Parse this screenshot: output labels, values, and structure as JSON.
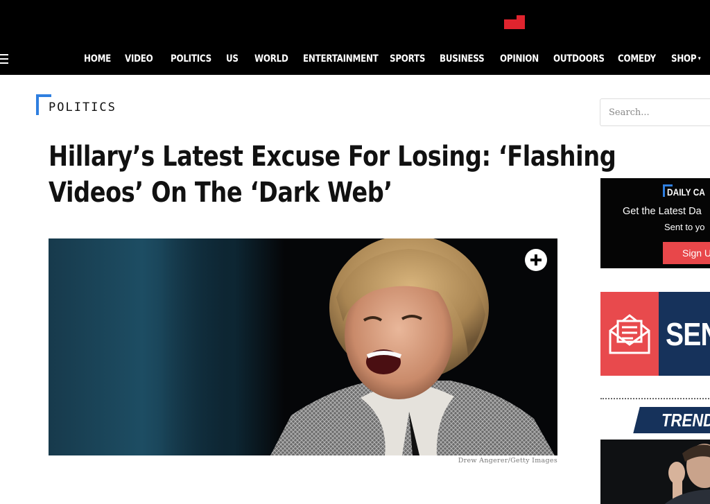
{
  "header": {
    "nav": [
      {
        "label": "HOME"
      },
      {
        "label": "VIDEO"
      },
      {
        "label": "POLITICS"
      },
      {
        "label": "US"
      },
      {
        "label": "WORLD"
      },
      {
        "label": "ENTERTAINMENT"
      },
      {
        "label": "SPORTS"
      },
      {
        "label": "BUSINESS"
      },
      {
        "label": "OPINION"
      },
      {
        "label": "OUTDOORS"
      },
      {
        "label": "COMEDY"
      },
      {
        "label": "SHOP"
      }
    ],
    "shop_caret": "▾",
    "colors": {
      "background": "#000000",
      "logo_accent": "#e0242e"
    }
  },
  "article": {
    "section": "POLITICS",
    "headline_line1": "Hillary’s Latest Excuse For Losing: ‘Flashing",
    "headline_line2": "Videos’ On The ‘Dark Web’",
    "caption": "Drew Angerer/Getty Images",
    "section_accent": "#2f7fe0"
  },
  "sidebar": {
    "search_placeholder": "Search...",
    "newsletter": {
      "brand": "DAILY CA",
      "line1": "Get the Latest Da",
      "line2": "Sent to yo",
      "signup": "Sign U",
      "button_color": "#e8474a"
    },
    "send_ad": {
      "text": "SEN",
      "left_color": "#e84a4d",
      "right_color": "#16325b"
    },
    "trending": {
      "label": "TREND",
      "color": "#16325b"
    }
  }
}
